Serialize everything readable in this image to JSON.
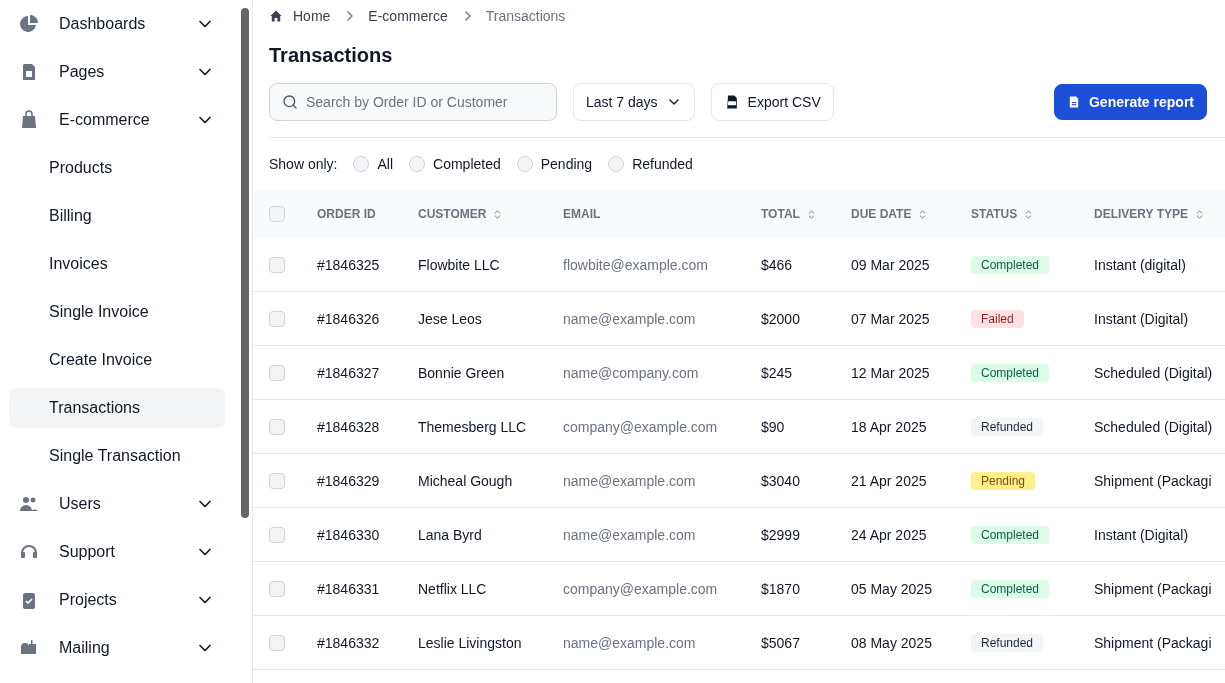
{
  "sidebar": {
    "items": [
      {
        "label": "Dashboards",
        "selected": false
      },
      {
        "label": "Pages",
        "selected": false
      },
      {
        "label": "E-commerce",
        "selected": false,
        "children": [
          {
            "label": "Products",
            "selected": false
          },
          {
            "label": "Billing",
            "selected": false
          },
          {
            "label": "Invoices",
            "selected": false
          },
          {
            "label": "Single Invoice",
            "selected": false
          },
          {
            "label": "Create Invoice",
            "selected": false
          },
          {
            "label": "Transactions",
            "selected": true
          },
          {
            "label": "Single Transaction",
            "selected": false
          }
        ]
      },
      {
        "label": "Users",
        "selected": false
      },
      {
        "label": "Support",
        "selected": false
      },
      {
        "label": "Projects",
        "selected": false
      },
      {
        "label": "Mailing",
        "selected": false
      }
    ]
  },
  "breadcrumb": [
    "Home",
    "E-commerce",
    "Transactions"
  ],
  "title": "Transactions",
  "search": {
    "placeholder": "Search by Order ID or Customer"
  },
  "date_filter": "Last 7 days",
  "export_button": "Export CSV",
  "report_button": "Generate report",
  "filter": {
    "label": "Show only:",
    "options": [
      {
        "label": "All",
        "selected": false
      },
      {
        "label": "Completed",
        "selected": false
      },
      {
        "label": "Pending",
        "selected": false
      },
      {
        "label": "Refunded",
        "selected": false
      }
    ]
  },
  "table": {
    "all_checked": false,
    "columns": [
      {
        "label": "ORDER ID",
        "sortable": false
      },
      {
        "label": "CUSTOMER",
        "sortable": true
      },
      {
        "label": "EMAIL",
        "sortable": false
      },
      {
        "label": "TOTAL",
        "sortable": true
      },
      {
        "label": "DUE DATE",
        "sortable": true
      },
      {
        "label": "STATUS",
        "sortable": true
      },
      {
        "label": "DELIVERY TYPE",
        "sortable": true
      }
    ],
    "rows": [
      {
        "checked": false,
        "order_id": "#1846325",
        "customer": "Flowbite LLC",
        "email": "flowbite@example.com",
        "total": "$466",
        "due_date": "09 Mar 2025",
        "status": {
          "label": "Completed",
          "kind": "completed"
        },
        "delivery": "Instant (digital)"
      },
      {
        "checked": false,
        "order_id": "#1846326",
        "customer": "Jese Leos",
        "email": "name@example.com",
        "total": "$2000",
        "due_date": "07 Mar 2025",
        "status": {
          "label": "Failed",
          "kind": "failed"
        },
        "delivery": "Instant (Digital)"
      },
      {
        "checked": false,
        "order_id": "#1846327",
        "customer": "Bonnie Green",
        "email": "name@company.com",
        "total": "$245",
        "due_date": "12 Mar 2025",
        "status": {
          "label": "Completed",
          "kind": "completed"
        },
        "delivery": "Scheduled (Digital)"
      },
      {
        "checked": false,
        "order_id": "#1846328",
        "customer": "Themesberg LLC",
        "email": "company@example.com",
        "total": "$90",
        "due_date": "18 Apr 2025",
        "status": {
          "label": "Refunded",
          "kind": "refunded"
        },
        "delivery": "Scheduled (Digital)"
      },
      {
        "checked": false,
        "order_id": "#1846329",
        "customer": "Micheal Gough",
        "email": "name@example.com",
        "total": "$3040",
        "due_date": "21 Apr 2025",
        "status": {
          "label": "Pending",
          "kind": "pending"
        },
        "delivery": "Shipment (Packagi"
      },
      {
        "checked": false,
        "order_id": "#1846330",
        "customer": "Lana Byrd",
        "email": "name@example.com",
        "total": "$2999",
        "due_date": "24 Apr 2025",
        "status": {
          "label": "Completed",
          "kind": "completed"
        },
        "delivery": "Instant (Digital)"
      },
      {
        "checked": false,
        "order_id": "#1846331",
        "customer": "Netflix LLC",
        "email": "company@example.com",
        "total": "$1870",
        "due_date": "05 May 2025",
        "status": {
          "label": "Completed",
          "kind": "completed"
        },
        "delivery": "Shipment (Packagi"
      },
      {
        "checked": false,
        "order_id": "#1846332",
        "customer": "Leslie Livingston",
        "email": "name@example.com",
        "total": "$5067",
        "due_date": "08 May 2025",
        "status": {
          "label": "Refunded",
          "kind": "refunded"
        },
        "delivery": "Shipment (Packagi"
      }
    ]
  }
}
